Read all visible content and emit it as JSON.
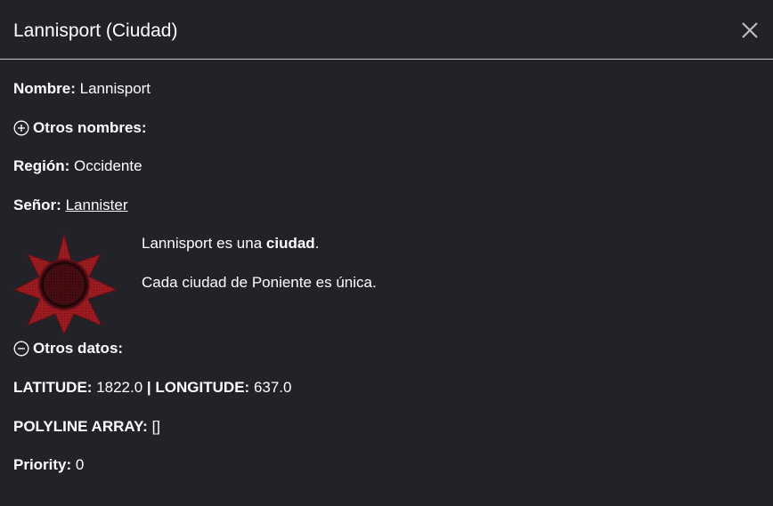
{
  "dialog": {
    "title": "Lannisport (Ciudad)",
    "close_icon": "close-icon"
  },
  "fields": {
    "nombre_label": "Nombre:",
    "nombre_value": "Lannisport",
    "otros_nombres_label": "Otros nombres:",
    "otros_nombres_icon": "plus-circle-icon",
    "region_label": "Región:",
    "region_value": "Occidente",
    "senor_label": "Señor:",
    "senor_value": "Lannister"
  },
  "description": {
    "emblem_icon": "red-star-emblem",
    "line1_prefix": "Lannisport es una ",
    "line1_bold": "ciudad",
    "line1_suffix": ".",
    "line2": "Cada ciudad de Poniente es única."
  },
  "otros_datos": {
    "label": "Otros datos:",
    "icon": "minus-circle-icon",
    "latitude_label": "LATITUDE:",
    "latitude_value": "1822.0",
    "separator": "|",
    "longitude_label": "LONGITUDE:",
    "longitude_value": "637.0",
    "polyline_label": "POLYLINE ARRAY:",
    "polyline_value": "[]",
    "priority_label": "Priority:",
    "priority_value": "0"
  },
  "colors": {
    "background": "#212329",
    "text": "#ffffff",
    "divider": "#c8c9cc",
    "emblem_red": "#9e1c22"
  }
}
